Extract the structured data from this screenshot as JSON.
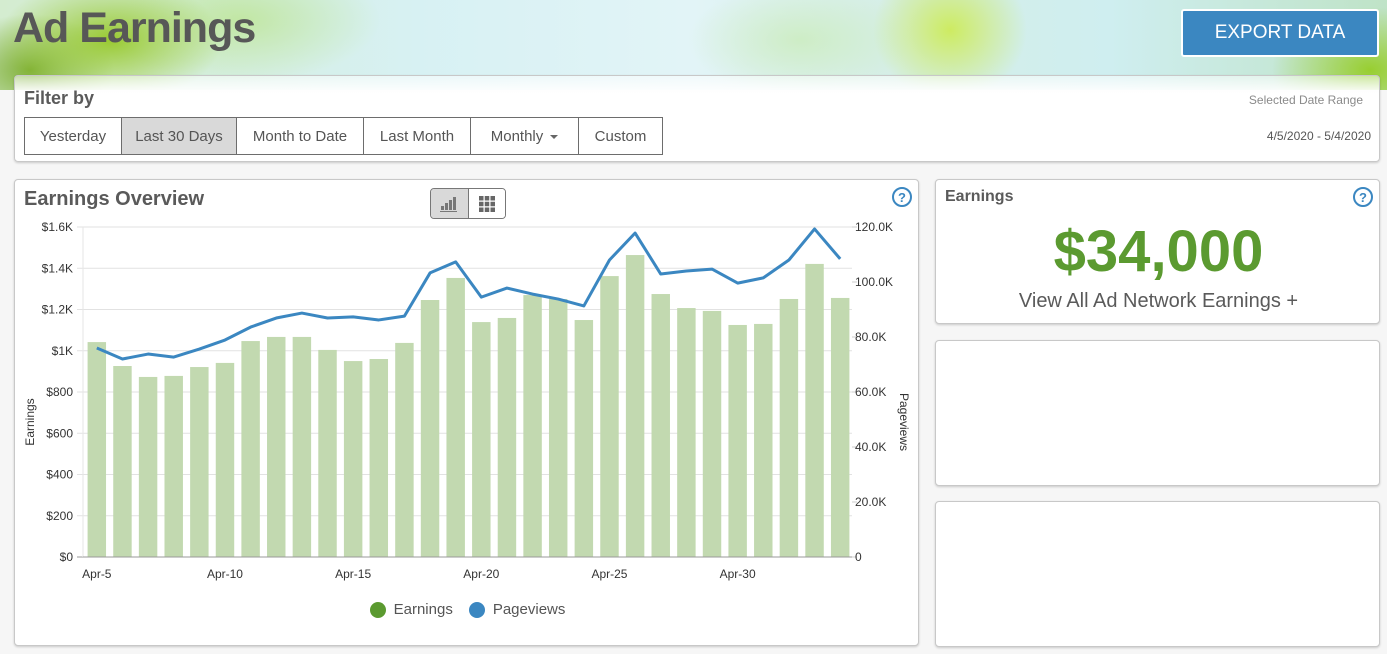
{
  "header": {
    "title": "Ad Earnings",
    "export_label": "EXPORT DATA"
  },
  "filter": {
    "label": "Filter by",
    "buttons": [
      {
        "label": "Yesterday",
        "active": false
      },
      {
        "label": "Last 30 Days",
        "active": true
      },
      {
        "label": "Month to Date",
        "active": false
      },
      {
        "label": "Last Month",
        "active": false
      },
      {
        "label": "Monthly",
        "active": false,
        "dropdown": true
      },
      {
        "label": "Custom",
        "active": false
      }
    ],
    "date_range_label": "Selected Date Range",
    "date_range_value": "4/5/2020 - 5/4/2020"
  },
  "overview": {
    "title": "Earnings Overview",
    "toggles": [
      {
        "icon": "bar-chart-icon",
        "active": true
      },
      {
        "icon": "grid-icon",
        "active": false
      }
    ],
    "help_icon": "?"
  },
  "earnings_card": {
    "title": "Earnings",
    "value": "$34,000",
    "link": "View All Ad Network Earnings +",
    "help_icon": "?"
  },
  "colors": {
    "bars": "#c2d9b0",
    "line": "#3b87c1",
    "earnings_legend": "#5b9a30",
    "pageviews_legend": "#3b87c1",
    "accent": "#3b87c1",
    "earnings_value": "#5b9a30"
  },
  "chart_data": {
    "type": "bar",
    "title": "Earnings Overview",
    "categories": [
      "Apr-5",
      "Apr-6",
      "Apr-7",
      "Apr-8",
      "Apr-9",
      "Apr-10",
      "Apr-11",
      "Apr-12",
      "Apr-13",
      "Apr-14",
      "Apr-15",
      "Apr-16",
      "Apr-17",
      "Apr-18",
      "Apr-19",
      "Apr-20",
      "Apr-21",
      "Apr-22",
      "Apr-23",
      "Apr-24",
      "Apr-25",
      "Apr-26",
      "Apr-27",
      "Apr-28",
      "Apr-29",
      "Apr-30",
      "May-1",
      "May-2",
      "May-3",
      "May-4"
    ],
    "x_tick_labels": [
      "Apr-5",
      "Apr-10",
      "Apr-15",
      "Apr-20",
      "Apr-25",
      "Apr-30"
    ],
    "series": [
      {
        "name": "Earnings",
        "type": "bar",
        "axis": "left",
        "values": [
          1042,
          926,
          873,
          878,
          921,
          941,
          1047,
          1067,
          1067,
          1004,
          950,
          960,
          1038,
          1246,
          1353,
          1139,
          1159,
          1270,
          1251,
          1149,
          1362,
          1464,
          1275,
          1207,
          1193,
          1125,
          1130,
          1251,
          1421,
          1256
        ]
      },
      {
        "name": "Pageviews",
        "type": "line",
        "axis": "right",
        "values": [
          76000,
          72000,
          73800,
          72700,
          75600,
          78900,
          83600,
          86900,
          88700,
          86900,
          87300,
          86200,
          87600,
          103300,
          107300,
          94500,
          97800,
          95600,
          93800,
          91300,
          108000,
          117800,
          102900,
          104000,
          104700,
          99600,
          101500,
          108000,
          119300,
          108400
        ]
      }
    ],
    "ylabel": "Earnings",
    "ylim": [
      0,
      1600
    ],
    "y_ticks": [
      "$0",
      "$200",
      "$400",
      "$600",
      "$800",
      "$1K",
      "$1.2K",
      "$1.4K",
      "$1.6K"
    ],
    "y2label": "Pageviews",
    "y2lim": [
      0,
      120000
    ],
    "y2_ticks": [
      "0",
      "20.0K",
      "40.0K",
      "60.0K",
      "80.0K",
      "100.0K",
      "120.0K"
    ],
    "grid": true,
    "legend": [
      {
        "name": "Earnings",
        "color": "#5b9a30"
      },
      {
        "name": "Pageviews",
        "color": "#3b87c1"
      }
    ],
    "legend_position": "bottom"
  }
}
